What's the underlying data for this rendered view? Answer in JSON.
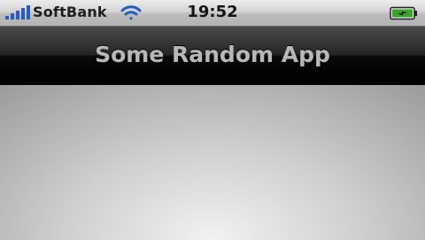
{
  "status_bar": {
    "carrier": "SoftBank",
    "time": "19:52",
    "signal_icon": "signal-bars-icon",
    "wifi_icon": "wifi-icon",
    "battery_icon": "battery-charging-icon",
    "signal_strength": 5,
    "battery_level": 1.0
  },
  "nav_bar": {
    "title": "Some Random App"
  },
  "colors": {
    "nav_title": "#b8b8b8",
    "status_text": "#1e1e1e",
    "accent_blue": "#2a5bbf",
    "battery_green": "#3aa32a"
  }
}
